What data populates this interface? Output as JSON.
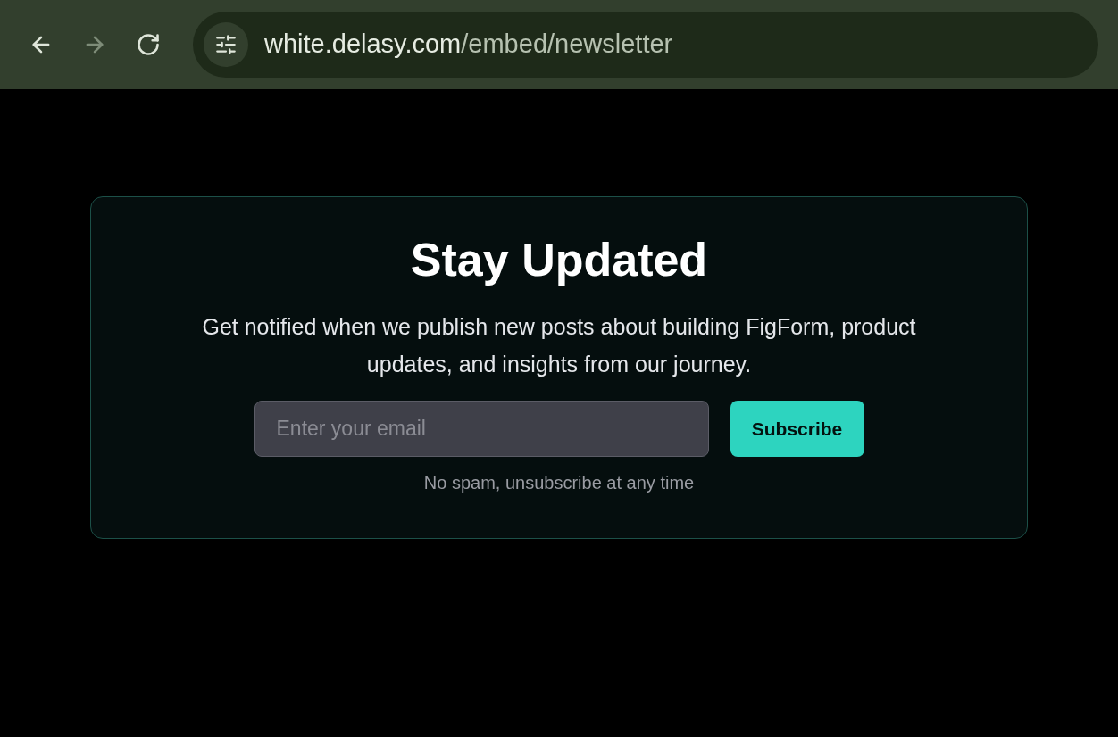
{
  "browser": {
    "nav_buttons": [
      {
        "kind": "back",
        "disabled": false
      },
      {
        "kind": "forward",
        "disabled": true
      },
      {
        "kind": "reload",
        "disabled": false
      }
    ],
    "address": {
      "host": "white.delasy.com",
      "path": "/embed/newsletter"
    }
  },
  "card": {
    "title": "Stay Updated",
    "description": "Get notified when we publish new posts about building FigForm, product updates, and insights from our journey.",
    "email_field": {
      "placeholder": "Enter your email"
    },
    "button": "Subscribe",
    "note": "No spam, unsubscribe at any time"
  }
}
